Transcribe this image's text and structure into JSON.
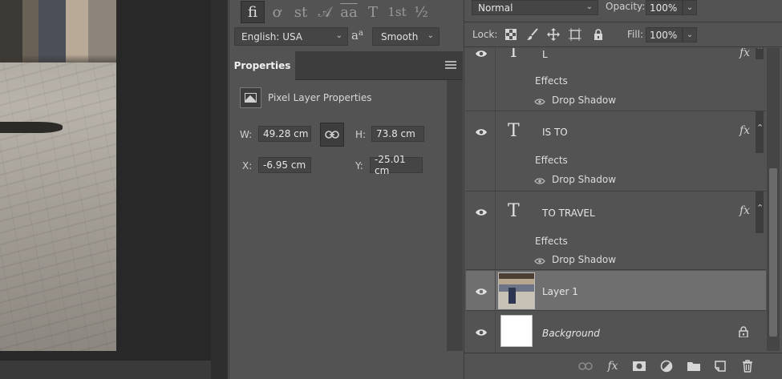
{
  "character_panel": {
    "glyphs": [
      "fi",
      "ơ",
      "st",
      "𝒜",
      "aa",
      "T",
      "1st",
      "½"
    ],
    "language": "English: USA",
    "aa_label": "aa",
    "anti_alias": "Smooth"
  },
  "properties": {
    "tab_label": "Properties",
    "title": "Pixel Layer Properties",
    "w_label": "W:",
    "w_value": "49.28 cm",
    "h_label": "H:",
    "h_value": "73.8 cm",
    "x_label": "X:",
    "x_value": "-6.95 cm",
    "y_label": "Y:",
    "y_value": "-25.01 cm"
  },
  "layers_panel": {
    "blend_mode": "Normal",
    "opacity_label": "Opacity:",
    "opacity_value": "100%",
    "lock_label": "Lock:",
    "fill_label": "Fill:",
    "fill_value": "100%",
    "fx_label": "fx",
    "layers": [
      {
        "name": "L",
        "type": "text",
        "effects_label": "Effects",
        "effect": "Drop Shadow"
      },
      {
        "name": "IS TO",
        "type": "text",
        "effects_label": "Effects",
        "effect": "Drop Shadow"
      },
      {
        "name": "TO TRAVEL",
        "type": "text",
        "effects_label": "Effects",
        "effect": "Drop Shadow"
      },
      {
        "name": "Layer 1",
        "type": "pixel",
        "selected": true
      },
      {
        "name": "Background",
        "type": "background",
        "locked": true
      }
    ]
  }
}
